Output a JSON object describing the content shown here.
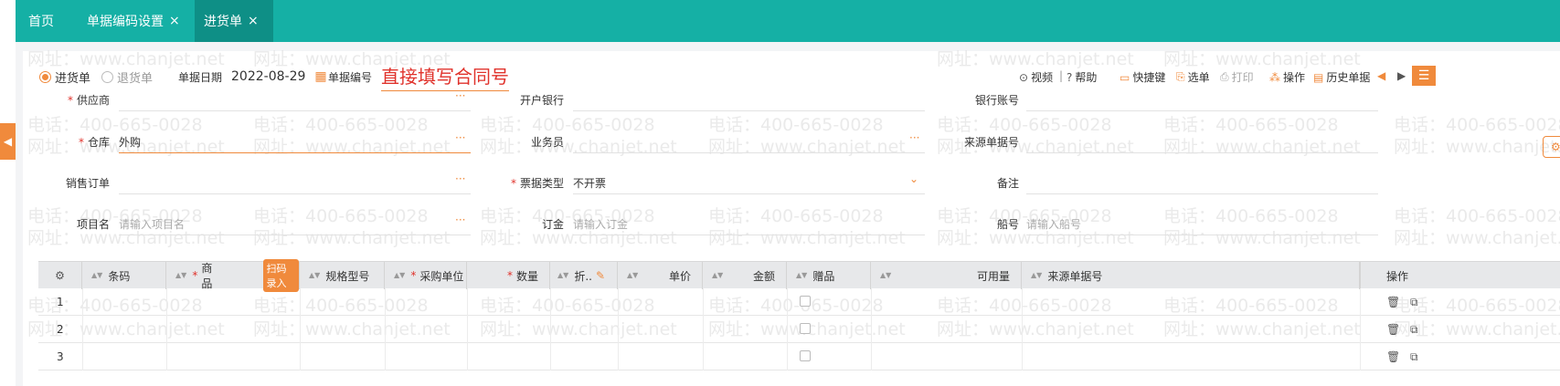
{
  "tabs": [
    {
      "label": "首页",
      "closable": false,
      "active": false
    },
    {
      "label": "单据编码设置",
      "closable": true,
      "active": false
    },
    {
      "label": "进货单",
      "closable": true,
      "active": true
    }
  ],
  "close_glyph": "×",
  "watermark": {
    "phone": "电话：400-665-0028",
    "site": "网址：www.chanjet.net"
  },
  "header": {
    "radio_purchase": "进货单",
    "radio_return": "退货单",
    "date_label": "单据日期",
    "date_value": "2022-08-29",
    "code_label": "单据编号",
    "code_value": "直接填写合同号"
  },
  "toolbar": {
    "video": "视频",
    "help": "帮助",
    "shortcut": "快捷键",
    "select_doc": "选单",
    "print": "打印",
    "operate": "操作",
    "history": "历史单据",
    "set_label": "设"
  },
  "form": {
    "supplier_label": "供应商",
    "bank_label": "开户银行",
    "account_label": "银行账号",
    "warehouse_label": "仓库",
    "warehouse_value": "外购",
    "salesman_label": "业务员",
    "source_no_label": "来源单据号",
    "sales_order_label": "销售订单",
    "invoice_type_label": "票据类型",
    "invoice_type_value": "不开票",
    "remark_label": "备注",
    "project_label": "项目名",
    "project_placeholder": "请输入项目名",
    "deposit_label": "订金",
    "deposit_placeholder": "请输入订金",
    "ship_label": "船号",
    "ship_placeholder": "请输入船号"
  },
  "table": {
    "columns": {
      "barcode": "条码",
      "product": "商品",
      "scan": "扫码录入",
      "spec": "规格型号",
      "unit": "采购单位",
      "qty": "数量",
      "discount": "折..",
      "price": "单价",
      "amount": "金额",
      "gift": "赠品",
      "available": "可用量",
      "source_no": "来源单据号",
      "ops": "操作"
    },
    "rows": [
      "1",
      "2",
      "3"
    ]
  }
}
